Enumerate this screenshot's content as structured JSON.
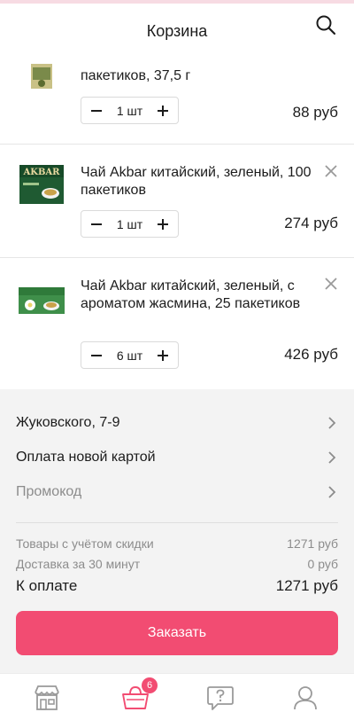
{
  "header": {
    "title": "Корзина",
    "search_icon": "search-icon"
  },
  "cart": {
    "items": [
      {
        "name": "пакетиков, 37,5 г",
        "qty": "1 шт",
        "price": "88 руб",
        "image": "tea-package-small"
      },
      {
        "name": "Чай Akbar китайский, зеленый, 100 пакетиков",
        "qty": "1 шт",
        "price": "274 руб",
        "image": "akbar-green-tea-box",
        "package_text": "AKBAR"
      },
      {
        "name": "Чай Akbar китайский, зеленый, с ароматом жасмина, 25 пакетиков",
        "qty": "6 шт",
        "price": "426 руб",
        "image": "akbar-jasmine-tea-box"
      }
    ]
  },
  "checkout": {
    "address": "Жуковского, 7-9",
    "payment": "Оплата новой картой",
    "promo": "Промокод",
    "summary": {
      "goods_label": "Товары с учётом скидки",
      "goods_value": "1271 руб",
      "delivery_label": "Доставка за 30 минут",
      "delivery_value": "0 руб",
      "total_label": "К оплате",
      "total_value": "1271 руб"
    },
    "order_button": "Заказать"
  },
  "tabbar": {
    "tabs": [
      {
        "name": "shop",
        "icon": "storefront-icon"
      },
      {
        "name": "cart",
        "icon": "basket-icon",
        "badge": "6"
      },
      {
        "name": "support",
        "icon": "question-bubble-icon"
      },
      {
        "name": "profile",
        "icon": "user-icon"
      }
    ]
  },
  "colors": {
    "accent": "#f24c72",
    "background_gray": "#f3f3f3",
    "text": "#1c1c1c",
    "muted_text": "#8c8c8c",
    "icon_gray": "#9a9a9a"
  }
}
